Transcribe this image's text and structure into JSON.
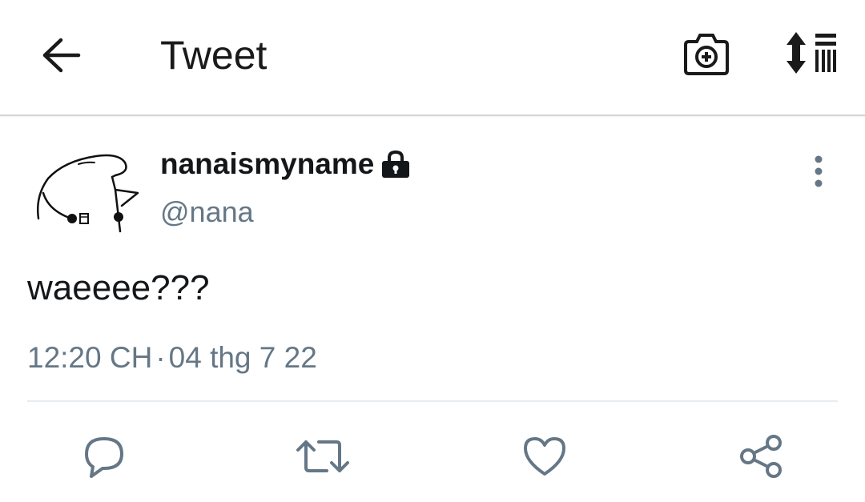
{
  "header": {
    "title": "Tweet",
    "back_icon": "arrow-left-icon",
    "camera_icon": "camera-plus-icon",
    "sort_icon": "sort-lines-icon"
  },
  "tweet": {
    "display_name": "nanaismyname",
    "handle": "@nana",
    "protected_icon": "lock-icon",
    "text": "waeeee???",
    "time": "12:20 CH",
    "separator": "·",
    "date": "04 thg 7 22"
  },
  "actions": {
    "reply_icon": "reply-icon",
    "retweet_icon": "retweet-icon",
    "like_icon": "heart-icon",
    "share_icon": "share-icon",
    "more_icon": "more-vertical-icon"
  },
  "colors": {
    "text_primary": "#14171a",
    "text_secondary": "#657786",
    "icon_gray": "#657786",
    "divider": "#e6ecf0"
  }
}
